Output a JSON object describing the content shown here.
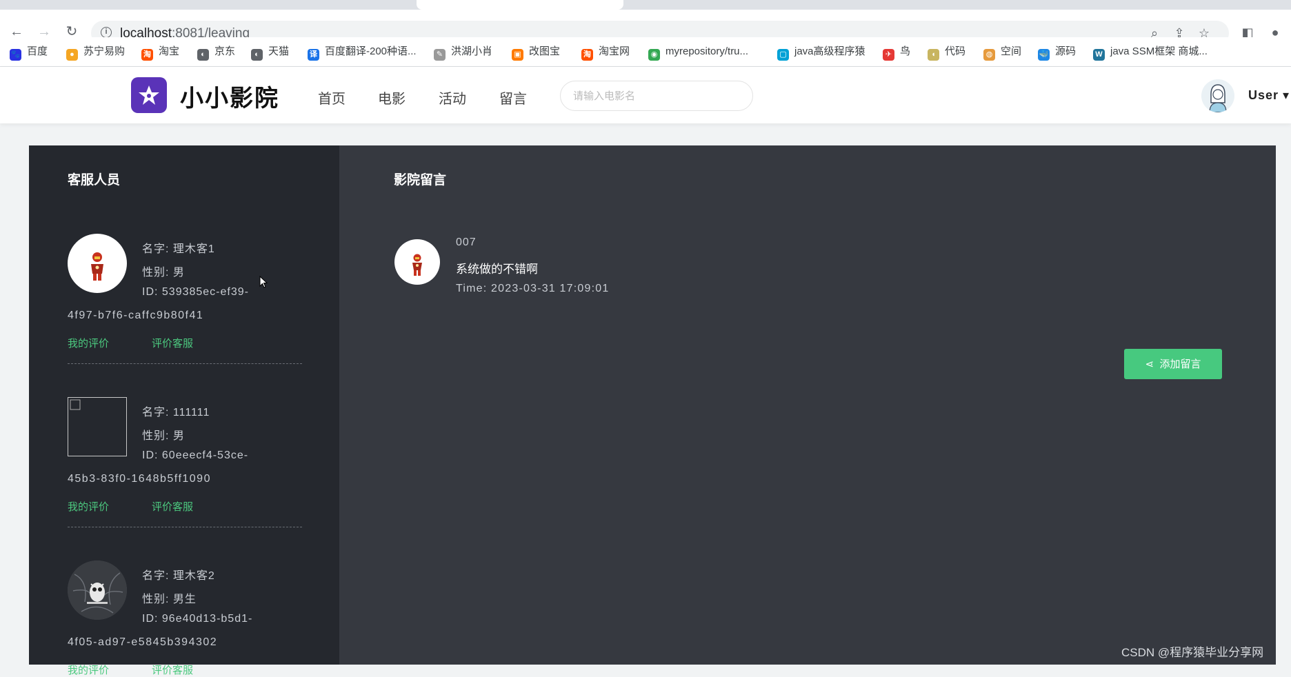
{
  "browser": {
    "url_host": "localhost",
    "url_path": ":8081/leaving",
    "bookmarks": [
      {
        "label": "百度",
        "color": "#2932e1",
        "glyph": "🐾"
      },
      {
        "label": "苏宁易购",
        "color": "#f5a623",
        "glyph": "●"
      },
      {
        "label": "淘宝",
        "color": "#ff5000",
        "glyph": "淘"
      },
      {
        "label": "京东",
        "color": "#5f6368",
        "glyph": "◐"
      },
      {
        "label": "天猫",
        "color": "#5f6368",
        "glyph": "◐"
      },
      {
        "label": "百度翻译-200种语...",
        "color": "#1a73e8",
        "glyph": "译"
      },
      {
        "label": "洪湖小肖",
        "color": "#999999",
        "glyph": "✎"
      },
      {
        "label": "改图宝",
        "color": "#ff7a00",
        "glyph": "▣"
      },
      {
        "label": "淘宝网",
        "color": "#ff5000",
        "glyph": "淘"
      },
      {
        "label": "myrepository/tru...",
        "color": "#34a853",
        "glyph": "◉"
      },
      {
        "label": "java高级程序猿",
        "color": "#00a1d6",
        "glyph": "▢"
      },
      {
        "label": "鸟",
        "color": "#e53935",
        "glyph": "✈"
      },
      {
        "label": "代码",
        "color": "#c8b560",
        "glyph": "◖"
      },
      {
        "label": "空间",
        "color": "#e69a3c",
        "glyph": "◍"
      },
      {
        "label": "源码",
        "color": "#1e88e5",
        "glyph": "🐳"
      },
      {
        "label": "java SSM框架 商城...",
        "color": "#21759b",
        "glyph": "W"
      }
    ]
  },
  "header": {
    "site_title": "小小影院",
    "nav": [
      "首页",
      "电影",
      "活动",
      "留言"
    ],
    "search_placeholder": "请输入电影名",
    "user_label": "User"
  },
  "left_panel": {
    "title": "客服人员",
    "staff": [
      {
        "name": "名字: 理木客1",
        "gender": "性别: 男",
        "id_line1": "ID: 539385ec-ef39-",
        "id_line2": "4f97-b7f6-caffc9b80f41",
        "link_my_reviews": "我的评价",
        "link_rate": "评价客服",
        "avatar": "ironman"
      },
      {
        "name": "名字: 111111",
        "gender": "性别: 男",
        "id_line1": "ID: 60eeecf4-53ce-",
        "id_line2": "45b3-83f0-1648b5ff1090",
        "link_my_reviews": "我的评价",
        "link_rate": "评价客服",
        "avatar": "broken"
      },
      {
        "name": "名字: 理木客2",
        "gender": "性别: 男生",
        "id_line1": "ID: 96e40d13-b5d1-",
        "id_line2": "4f05-ad97-e5845b394302",
        "link_my_reviews": "我的评价",
        "link_rate": "评价客服",
        "avatar": "owl"
      }
    ]
  },
  "right_panel": {
    "title": "影院留言",
    "messages": [
      {
        "user": "007",
        "text": "系统做的不错啊",
        "time": "Time: 2023-03-31 17:09:01"
      }
    ],
    "add_button": "添加留言"
  },
  "watermark": "CSDN @程序猿毕业分享网",
  "colors": {
    "accent_green": "#47c97f",
    "logo_purple": "#5a33b8",
    "left_bg": "#25282e",
    "right_bg": "#363940"
  }
}
